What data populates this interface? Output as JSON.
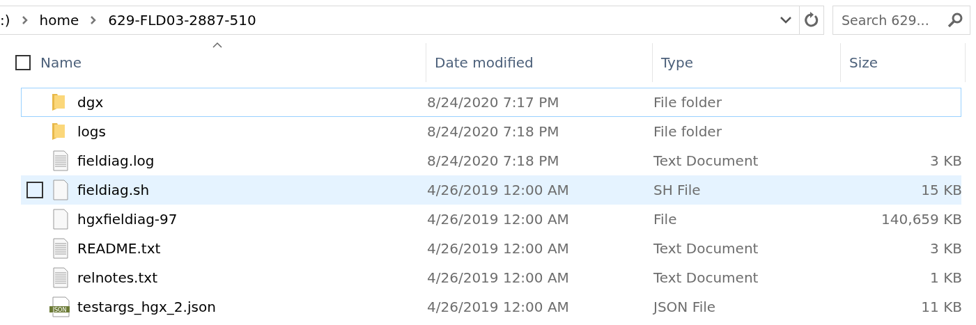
{
  "address_bar": {
    "crumbs": [
      ":)",
      "home",
      "629-FLD03-2887-510"
    ]
  },
  "search": {
    "placeholder": "Search 629..."
  },
  "select_all": {
    "checked": false
  },
  "columns": [
    {
      "label": "Name",
      "sorted": true
    },
    {
      "label": "Date modified",
      "sorted": false
    },
    {
      "label": "Type",
      "sorted": false
    },
    {
      "label": "Size",
      "sorted": false
    }
  ],
  "rows": [
    {
      "kind": "folder",
      "name": "dgx",
      "date": "8/24/2020 7:17 PM",
      "type": "File folder",
      "focused": true,
      "hovered": false
    },
    {
      "kind": "folder",
      "name": "logs",
      "date": "8/24/2020 7:18 PM",
      "type": "File folder",
      "focused": false,
      "hovered": false
    },
    {
      "kind": "text",
      "name": "fieldiag.log",
      "date": "8/24/2020 7:18 PM",
      "type": "Text Document",
      "size": "3 KB",
      "focused": false,
      "hovered": false
    },
    {
      "kind": "blank",
      "name": "fieldiag.sh",
      "date": "4/26/2019 12:00 AM",
      "type": "SH File",
      "size": "15 KB",
      "focused": false,
      "hovered": true
    },
    {
      "kind": "blank",
      "name": "hgxfieldiag-97",
      "date": "4/26/2019 12:00 AM",
      "type": "File",
      "size": "140,659 KB",
      "focused": false,
      "hovered": false
    },
    {
      "kind": "text",
      "name": "README.txt",
      "date": "4/26/2019 12:00 AM",
      "type": "Text Document",
      "size": "3 KB",
      "focused": false,
      "hovered": false
    },
    {
      "kind": "text",
      "name": "relnotes.txt",
      "date": "4/26/2019 12:00 AM",
      "type": "Text Document",
      "size": "1 KB",
      "focused": false,
      "hovered": false
    },
    {
      "kind": "json",
      "name": "testargs_hgx_2.json",
      "date": "4/26/2019 12:00 AM",
      "type": "JSON File",
      "size": "11 KB",
      "icon_label": "JSON",
      "focused": false,
      "hovered": false
    }
  ]
}
